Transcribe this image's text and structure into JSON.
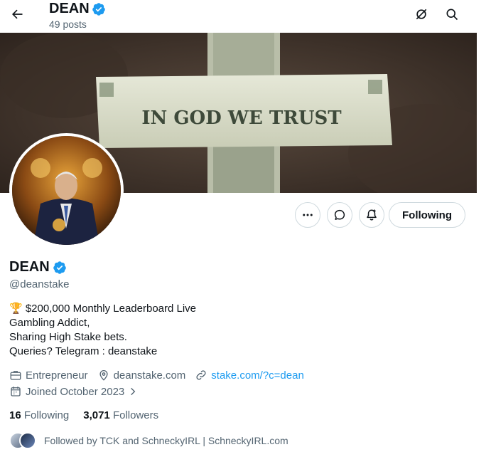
{
  "header": {
    "title": "DEAN",
    "posts_count": "49 posts"
  },
  "banner": {
    "text": "IN GOD WE TRUST"
  },
  "profile": {
    "name": "DEAN",
    "handle": "@deanstake",
    "bio_lines": [
      "🏆 $200,000 Monthly Leaderboard Live",
      "Gambling Addict,",
      "Sharing High Stake bets.",
      "Queries? Telegram : deanstake"
    ],
    "category": "Entrepreneur",
    "location": "deanstake.com",
    "website": "stake.com/?c=dean",
    "joined": "Joined October 2023",
    "following_count": "16",
    "following_label": "Following",
    "followers_count": "3,071",
    "followers_label": "Followers",
    "followed_by": "Followed by TCK and SchneckyIRL | SchneckyIRL.com"
  },
  "buttons": {
    "follow_state": "Following"
  },
  "icons": {
    "back": "arrow-left-icon",
    "top_right_1": "grok-slash-icon",
    "top_right_2": "search-icon",
    "more": "more-dots-icon",
    "message": "message-bubble-icon",
    "notify": "bell-plus-icon",
    "verified": "verified-badge-icon",
    "briefcase": "briefcase-icon",
    "location": "location-pin-icon",
    "link": "link-icon",
    "calendar": "calendar-icon",
    "chevron": "chevron-right-icon"
  },
  "colors": {
    "accent": "#1d9bf0",
    "text": "#0f1419",
    "secondary": "#536471",
    "border": "#cfd9de"
  }
}
